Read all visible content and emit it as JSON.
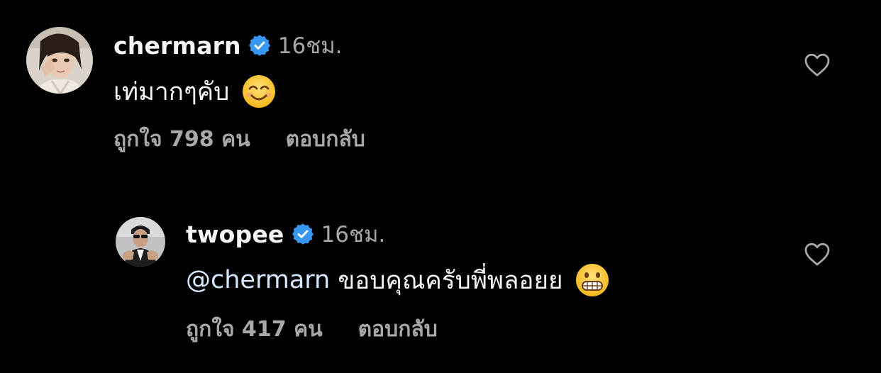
{
  "comments": [
    {
      "username": "chermarn",
      "timestamp": "16ชม.",
      "text": "เท่มากๆคับ",
      "emoji": "smiling-face-with-smiling-eyes",
      "likes": "ถูกใจ 798 คน",
      "reply_label": "ตอบกลับ",
      "verified": true
    },
    {
      "username": "twopee",
      "timestamp": "16ชม.",
      "mention": "@chermarn",
      "text": " ขอบคุณครับพี่พลอยย",
      "emoji": "grimacing-face",
      "likes": "ถูกใจ 417 คน",
      "reply_label": "ตอบกลับ",
      "verified": true
    }
  ],
  "colors": {
    "background": "#000000",
    "primary_text": "#f5f5f5",
    "secondary_text": "#a8a8a8",
    "verified_badge": "#3897f0",
    "mention": "#e0f1ff"
  },
  "icons": {
    "like": "heart-outline-icon",
    "verified": "verified-badge-icon"
  }
}
